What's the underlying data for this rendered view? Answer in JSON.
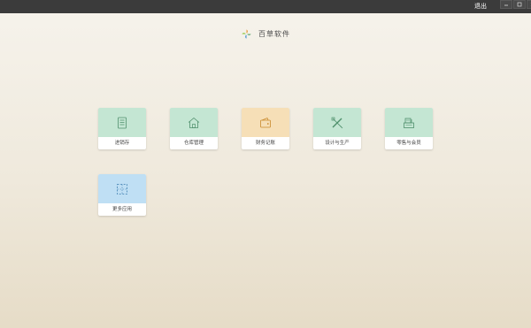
{
  "titlebar": {
    "logout_label": "退出"
  },
  "brand": {
    "name": "百草软件"
  },
  "tiles": [
    {
      "label": "进销存",
      "icon": "document-icon",
      "color": "#c4e6d3"
    },
    {
      "label": "仓库管理",
      "icon": "warehouse-icon",
      "color": "#c4e6d3"
    },
    {
      "label": "财务记账",
      "icon": "wallet-icon",
      "color": "#f6dfb7"
    },
    {
      "label": "设计与生产",
      "icon": "design-tools-icon",
      "color": "#c4e6d3"
    },
    {
      "label": "零售与会员",
      "icon": "cash-register-icon",
      "color": "#c4e6d3"
    },
    {
      "label": "更多应用",
      "icon": "more-apps-icon",
      "color": "#bfdff4"
    }
  ]
}
